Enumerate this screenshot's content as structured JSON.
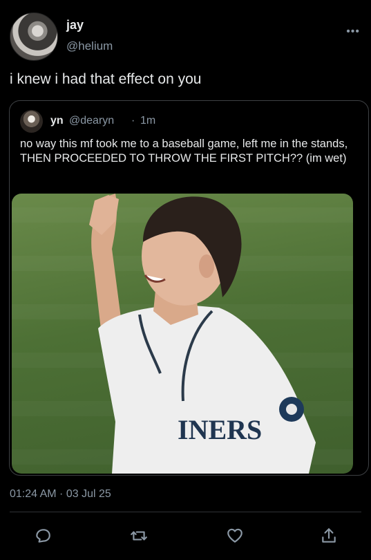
{
  "author": {
    "name": "jay",
    "handle": "@helium"
  },
  "tweet": {
    "text": "i knew i had that effect on you"
  },
  "quoted": {
    "name": "yn",
    "handle": "@dearyn",
    "separator": "·",
    "time": "1m",
    "text": "no way this mf took me to a baseball game, left me in the stands, THEN PROCEEDED TO THROW THE FIRST PITCH?? (im wet)",
    "image_jersey_text": "INERS"
  },
  "meta": {
    "timestamp": "01:24 AM · 03 Jul 25"
  },
  "icons": [
    "more-icon",
    "reply-icon",
    "retweet-icon",
    "like-icon",
    "share-icon"
  ],
  "colors": {
    "background": "#000000",
    "text": "#e7e9ea",
    "secondary": "#8b98a5",
    "border": "#3e4144"
  }
}
